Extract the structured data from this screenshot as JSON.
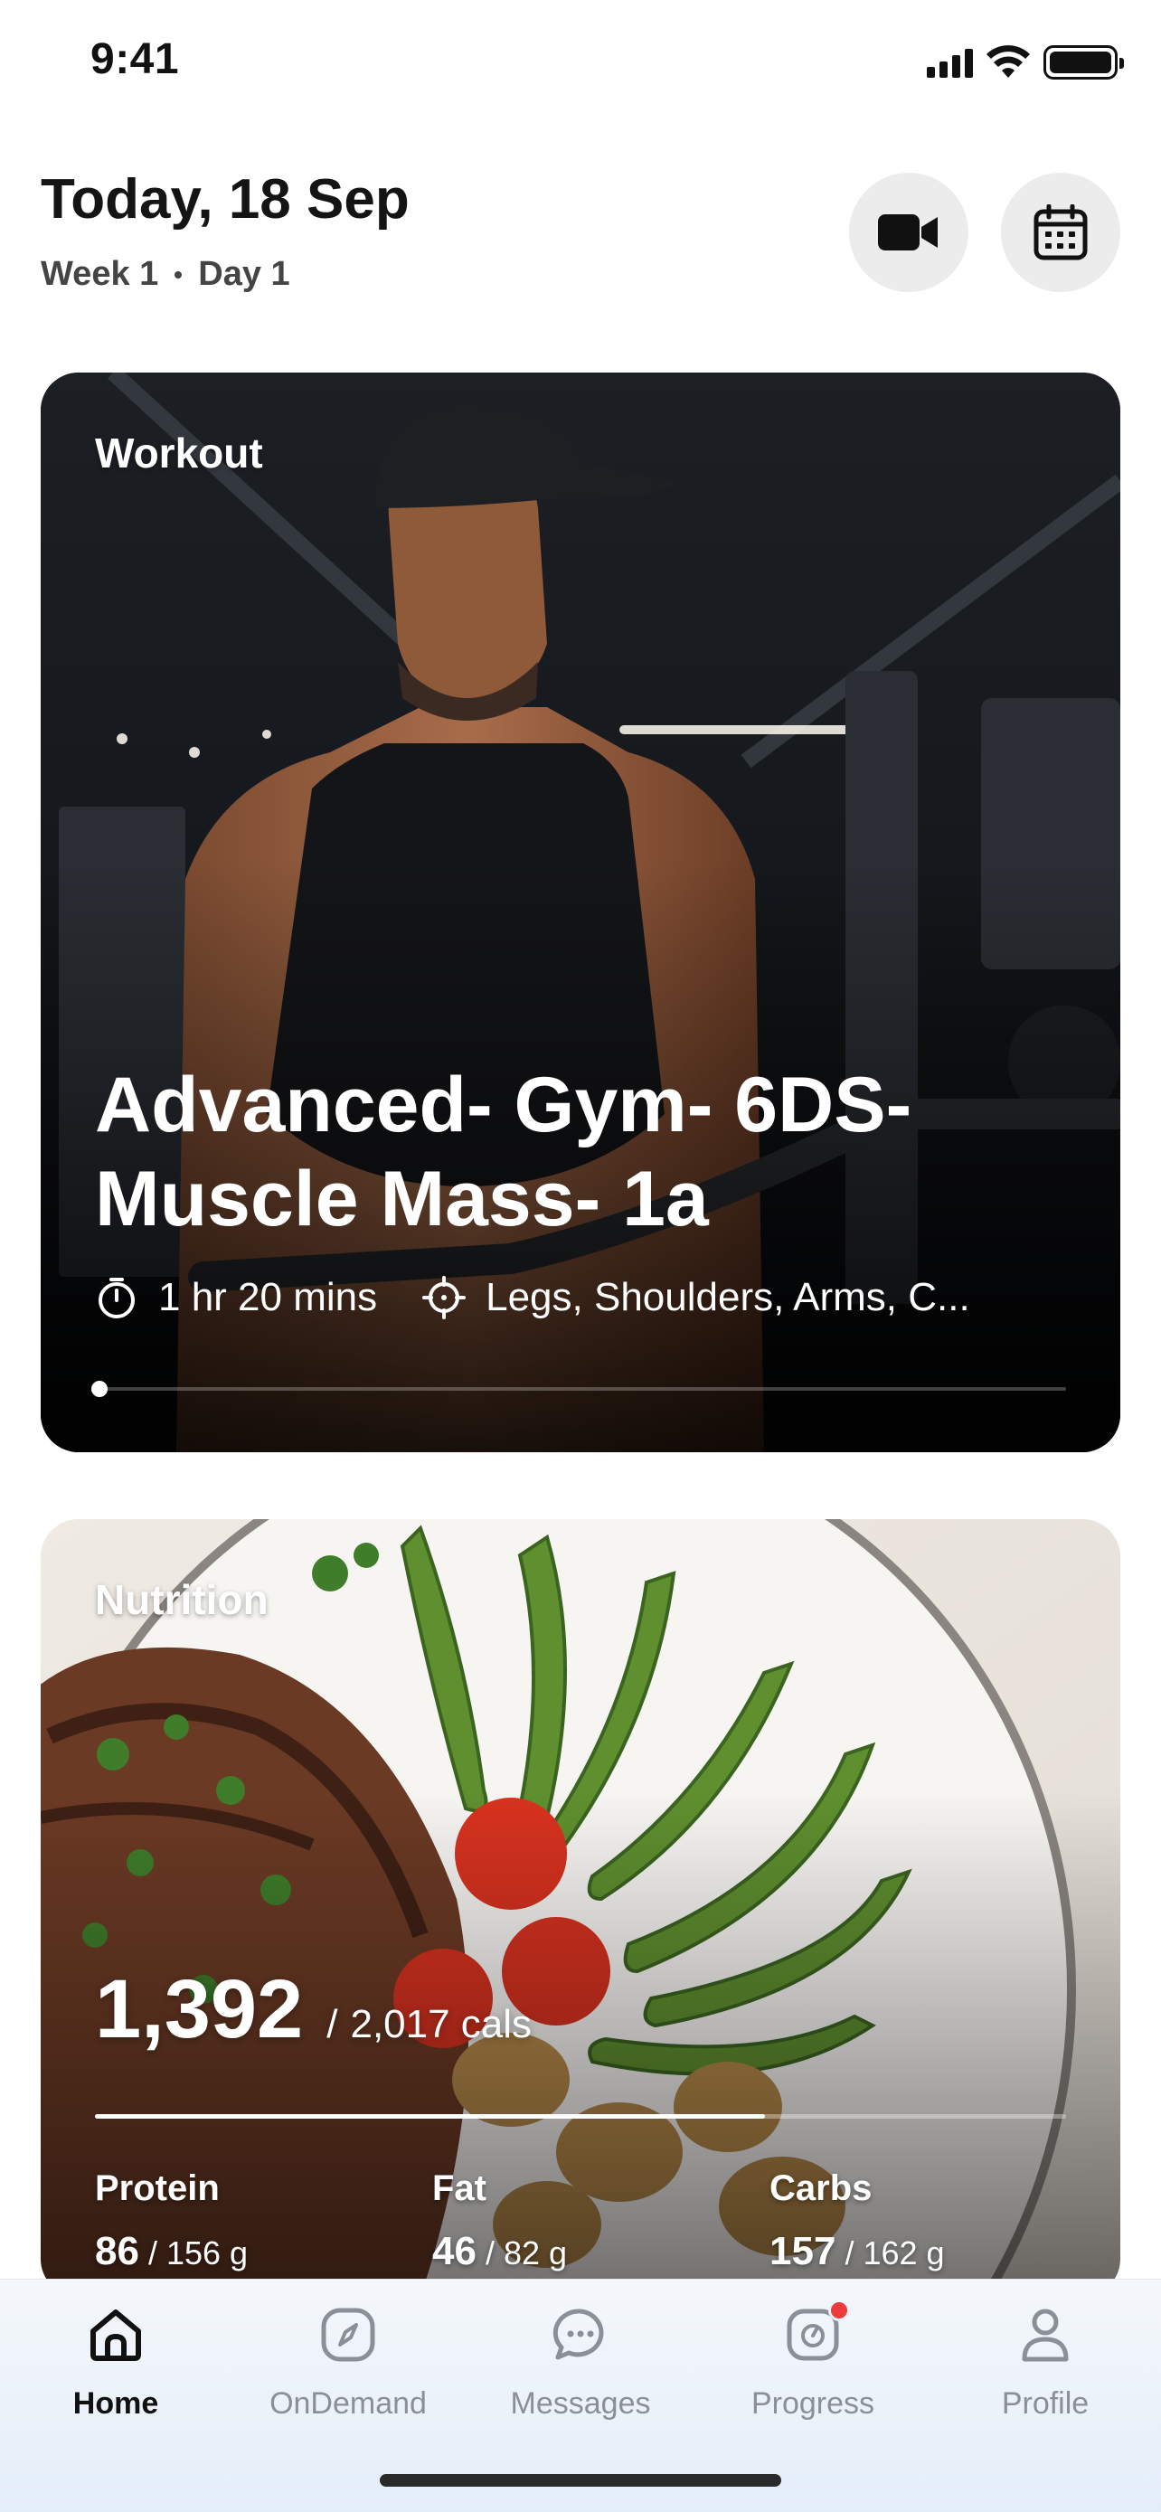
{
  "status_bar": {
    "time": "9:41",
    "icons": [
      "cellular-signal-icon",
      "wifi-icon",
      "battery-icon"
    ]
  },
  "header": {
    "title": "Today, 18 Sep",
    "week": "Week 1",
    "day": "Day 1",
    "buttons": [
      "video-camera-icon",
      "calendar-icon"
    ]
  },
  "workout": {
    "label": "Workout",
    "title": "Advanced- Gym- 6DS- Muscle Mass- 1a",
    "duration": "1 hr 20 mins",
    "focus": "Legs, Shoulders, Arms, C...",
    "progress": 0
  },
  "nutrition": {
    "label": "Nutrition",
    "calories_consumed": "1,392",
    "calories_separator": "/",
    "calories_target": "2,017 cals",
    "calorie_progress": 0.69,
    "macros": [
      {
        "name": "Protein",
        "value": "86",
        "target": "/ 156 g"
      },
      {
        "name": "Fat",
        "value": "46",
        "target": "/ 82 g"
      },
      {
        "name": "Carbs",
        "value": "157",
        "target": "/ 162 g"
      }
    ]
  },
  "tabbar": {
    "active": "Home",
    "tabs": [
      {
        "label": "Home",
        "icon": "home-icon"
      },
      {
        "label": "OnDemand",
        "icon": "compass-icon"
      },
      {
        "label": "Messages",
        "icon": "chat-bubble-icon"
      },
      {
        "label": "Progress",
        "icon": "scale-icon",
        "badge": true
      },
      {
        "label": "Profile",
        "icon": "person-icon"
      }
    ]
  },
  "colors": {
    "badge": "#ee3b3b",
    "active_tab": "#111111",
    "inactive_tab": "#8a8f98",
    "header_button_bg": "#ececec"
  }
}
